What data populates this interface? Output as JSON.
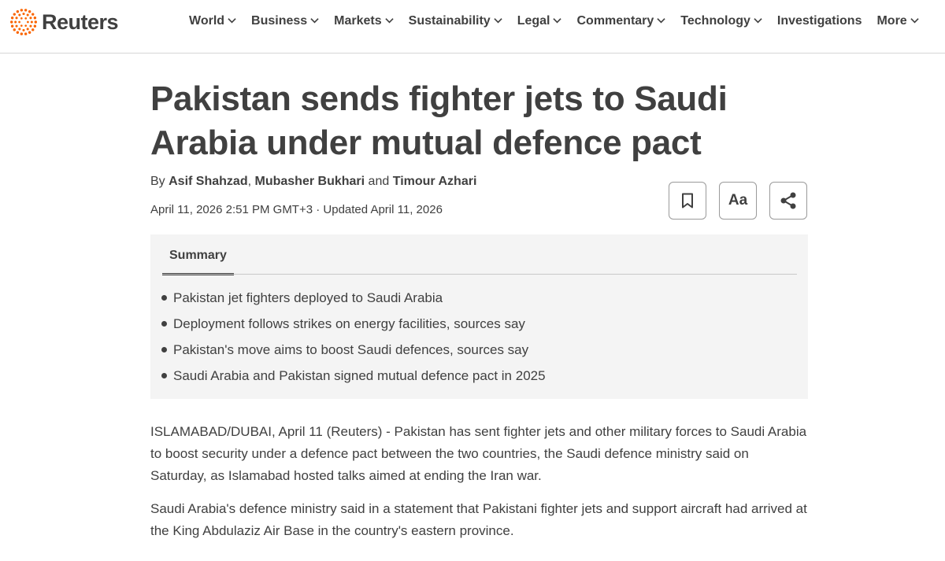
{
  "header": {
    "brand": "Reuters",
    "brand_color": "#fa6400",
    "nav": [
      {
        "label": "World",
        "dropdown": true
      },
      {
        "label": "Business",
        "dropdown": true
      },
      {
        "label": "Markets",
        "dropdown": true
      },
      {
        "label": "Sustainability",
        "dropdown": true
      },
      {
        "label": "Legal",
        "dropdown": true
      },
      {
        "label": "Commentary",
        "dropdown": true
      },
      {
        "label": "Technology",
        "dropdown": true
      },
      {
        "label": "Investigations",
        "dropdown": false
      },
      {
        "label": "More",
        "dropdown": true
      }
    ]
  },
  "article": {
    "headline_line1": "Pakistan sends fighter jets to Saudi",
    "headline_line2": "Arabia under mutual defence pact",
    "byline": {
      "prefix": "By",
      "authors": [
        "Asif Shahzad",
        "Mubasher Bukhari",
        "Timour Azhari"
      ],
      "separator": ",",
      "conjunction": "and"
    },
    "dateline": "April 11, 2026 2:51 PM GMT+3 · Updated April 11, 2026",
    "tools": {
      "bookmark_icon": "bookmark-icon",
      "text_size_label": "Aa",
      "share_icon": "share-icon"
    },
    "summary": {
      "tab_label": "Summary",
      "bullets": [
        "Pakistan jet fighters deployed to Saudi Arabia",
        "Deployment follows strikes on energy facilities, sources say",
        "Pakistan's move aims to boost Saudi defences, sources say",
        "Saudi Arabia and Pakistan signed mutual defence pact in 2025"
      ]
    },
    "paragraphs": [
      "ISLAMABAD/DUBAI, April 11 (Reuters) - Pakistan has sent fighter jets and other military forces to Saudi Arabia to boost security under a defence pact between the two countries, the Saudi defence ministry said on Saturday, as Islamabad hosted talks aimed at ending the Iran war.",
      "Saudi Arabia's defence ministry said in a statement that Pakistani fighter jets and support aircraft had arrived at the King Abdulaziz Air Base in the country's eastern province."
    ]
  }
}
